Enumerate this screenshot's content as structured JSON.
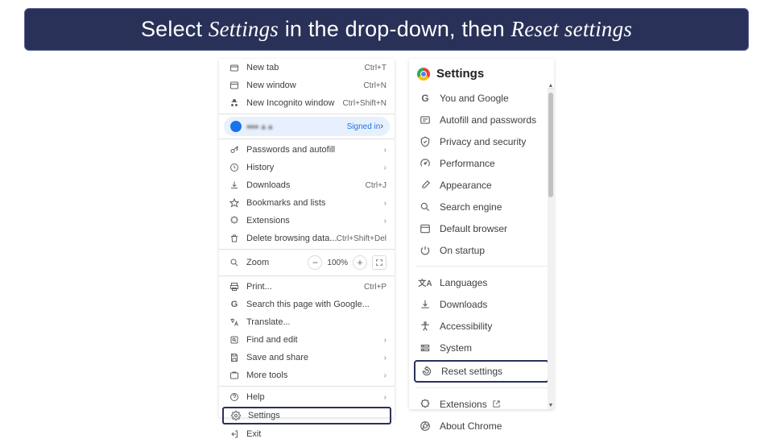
{
  "banner": {
    "prefix": "Select ",
    "em1": "Settings",
    "mid": " in the drop-down, then ",
    "em2": "Reset settings"
  },
  "dropdown": {
    "newTab": {
      "label": "New tab",
      "shortcut": "Ctrl+T"
    },
    "newWindow": {
      "label": "New window",
      "shortcut": "Ctrl+N"
    },
    "newIncognito": {
      "label": "New Incognito window",
      "shortcut": "Ctrl+Shift+N"
    },
    "signedIn": "Signed in",
    "passwords": {
      "label": "Passwords and autofill"
    },
    "history": {
      "label": "History"
    },
    "downloads": {
      "label": "Downloads",
      "shortcut": "Ctrl+J"
    },
    "bookmarks": {
      "label": "Bookmarks and lists"
    },
    "extensions": {
      "label": "Extensions"
    },
    "deleteData": {
      "label": "Delete browsing data...",
      "shortcut": "Ctrl+Shift+Del"
    },
    "zoom": {
      "label": "Zoom",
      "value": "100%"
    },
    "print": {
      "label": "Print...",
      "shortcut": "Ctrl+P"
    },
    "search": {
      "label": "Search this page with Google..."
    },
    "translate": {
      "label": "Translate..."
    },
    "findEdit": {
      "label": "Find and edit"
    },
    "saveShare": {
      "label": "Save and share"
    },
    "moreTools": {
      "label": "More tools"
    },
    "help": {
      "label": "Help"
    },
    "settings": {
      "label": "Settings"
    },
    "exit": {
      "label": "Exit"
    }
  },
  "settings": {
    "title": "Settings",
    "youGoogle": "You and Google",
    "autofill": "Autofill and passwords",
    "privacy": "Privacy and security",
    "performance": "Performance",
    "appearance": "Appearance",
    "searchEngine": "Search engine",
    "defaultBrowser": "Default browser",
    "onStartup": "On startup",
    "languages": "Languages",
    "downloads": "Downloads",
    "accessibility": "Accessibility",
    "system": "System",
    "resetSettings": "Reset settings",
    "ext": "Extensions",
    "about": "About Chrome"
  }
}
